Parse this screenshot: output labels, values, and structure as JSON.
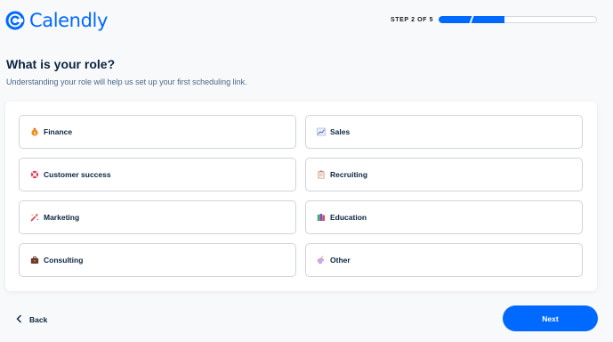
{
  "brand": {
    "name": "Calendly",
    "color": "#0069ff"
  },
  "progress": {
    "label": "STEP 2 OF 5",
    "current_step": 2,
    "total_steps": 5
  },
  "page": {
    "title": "What is your role?",
    "subtitle": "Understanding your role will help us set up your first scheduling link."
  },
  "roles": [
    {
      "label": "Finance",
      "icon": "money-bag-icon"
    },
    {
      "label": "Sales",
      "icon": "chart-icon"
    },
    {
      "label": "Customer success",
      "icon": "lifebuoy-icon"
    },
    {
      "label": "Recruiting",
      "icon": "clipboard-icon"
    },
    {
      "label": "Marketing",
      "icon": "megaphone-icon"
    },
    {
      "label": "Education",
      "icon": "books-icon"
    },
    {
      "label": "Consulting",
      "icon": "briefcase-icon"
    },
    {
      "label": "Other",
      "icon": "unicorn-icon"
    }
  ],
  "footer": {
    "back_label": "Back",
    "next_label": "Next"
  }
}
